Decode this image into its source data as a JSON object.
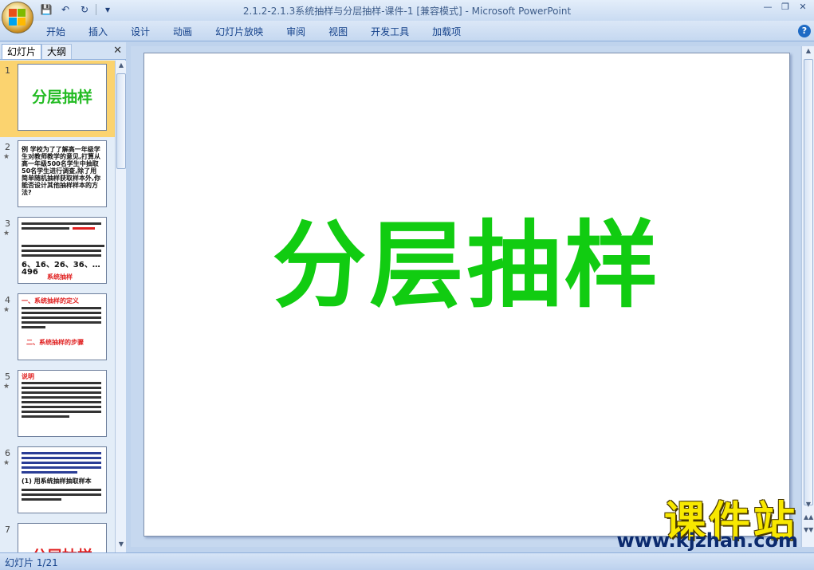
{
  "window": {
    "title": "2.1.2-2.1.3系统抽样与分层抽样-课件-1 [兼容模式] - Microsoft PowerPoint"
  },
  "ribbon": {
    "tabs": [
      "开始",
      "插入",
      "设计",
      "动画",
      "幻灯片放映",
      "审阅",
      "视图",
      "开发工具",
      "加载项"
    ]
  },
  "panel": {
    "tab_slides": "幻灯片",
    "tab_outline": "大纲"
  },
  "thumbnails": [
    {
      "num": "1",
      "title": "分层抽样"
    },
    {
      "num": "2",
      "text": "例 学校为了了解高一年级学生对教师教学的意见,打算从高一年级500名学生中抽取50名学生进行调查,除了用简单随机抽样获取样本外,你能否设计其他抽样样本的方法?"
    },
    {
      "num": "3",
      "text": "6、16、26、36、…496",
      "label": "系统抽样"
    },
    {
      "num": "4",
      "heading1": "一、系统抽样的定义",
      "heading2": "二、系统抽样的步骤"
    },
    {
      "num": "5",
      "heading": "说明"
    },
    {
      "num": "6",
      "text": "(1) 用系统抽样抽取样本"
    },
    {
      "num": "7",
      "title": "分层抽样"
    }
  ],
  "slide": {
    "title": "分层抽样",
    "title_color": "#11cc11"
  },
  "status": {
    "slide_info": "幻灯片 1/21"
  },
  "watermark": {
    "chars": "课件站",
    "url": "www.kjzhan.com"
  }
}
